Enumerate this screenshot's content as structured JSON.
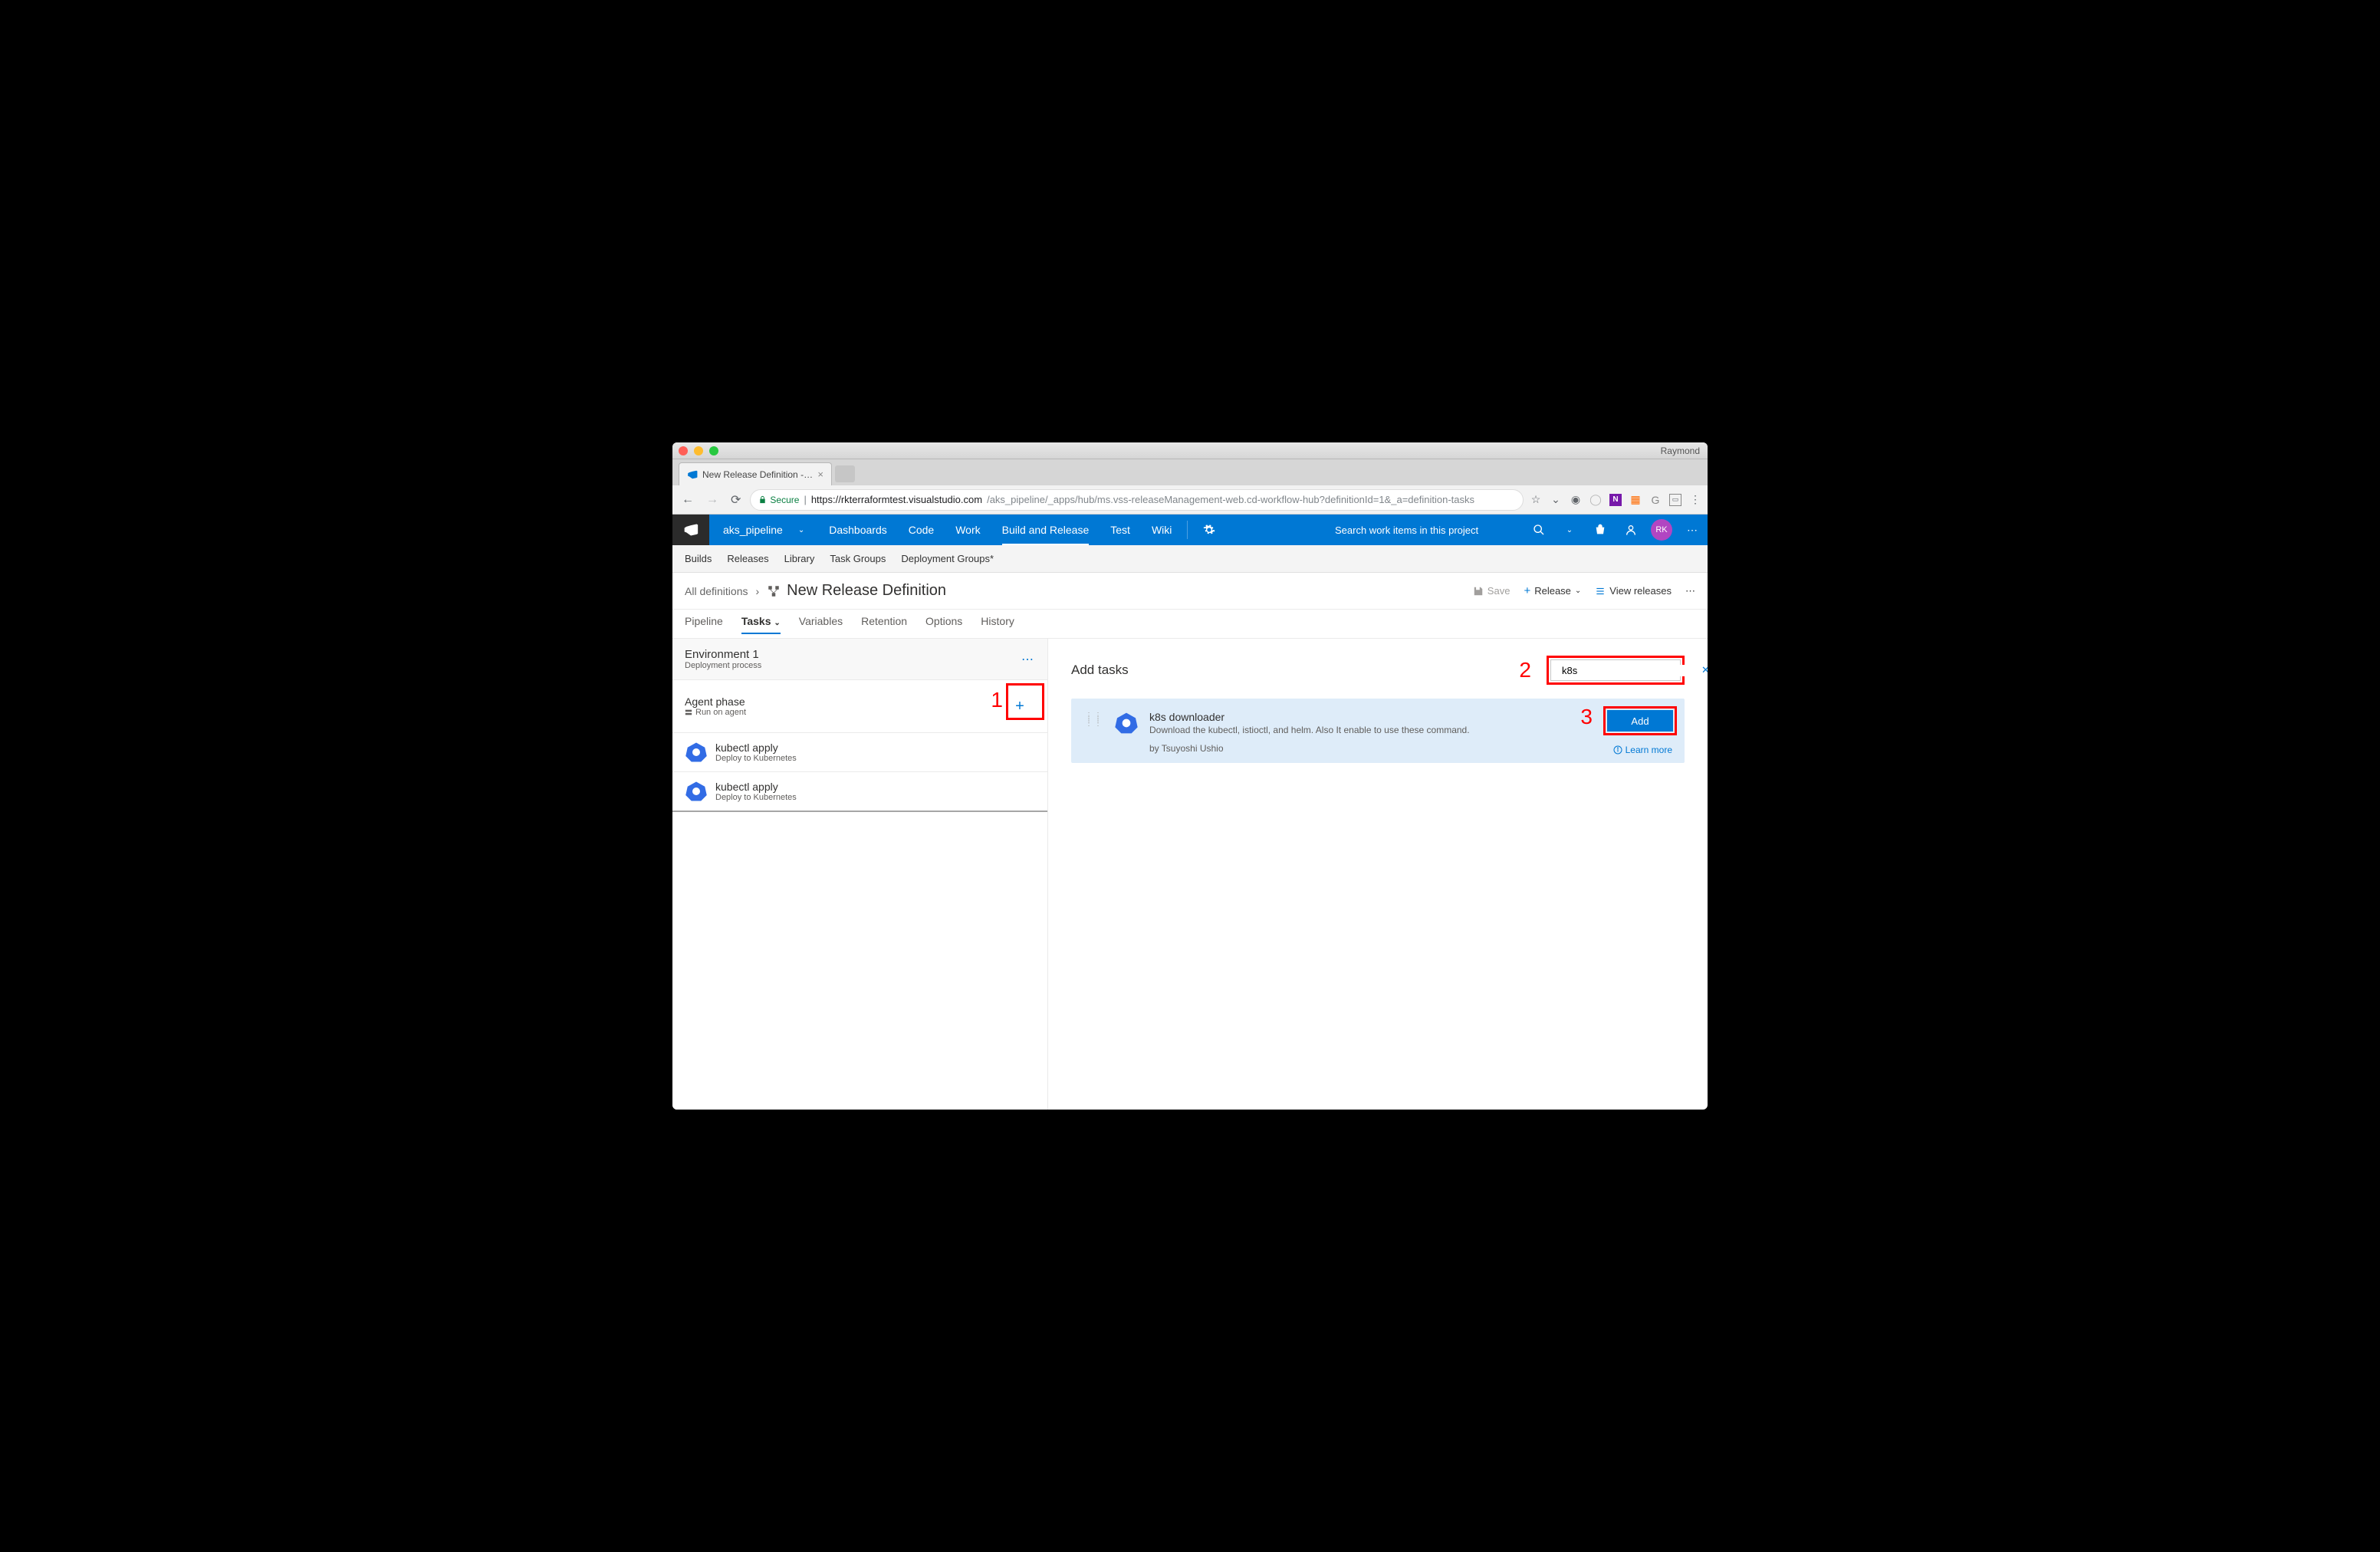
{
  "window": {
    "mac_user": "Raymond",
    "tab_title": "New Release Definition - Visua",
    "secure_label": "Secure",
    "url_host": "https://rkterraformtest.visualstudio.com",
    "url_path": "/aks_pipeline/_apps/hub/ms.vss-releaseManagement-web.cd-workflow-hub?definitionId=1&_a=definition-tasks"
  },
  "vsts_nav": {
    "project": "aks_pipeline",
    "items": [
      "Dashboards",
      "Code",
      "Work",
      "Build and Release",
      "Test",
      "Wiki"
    ],
    "active_index": 3,
    "search_placeholder": "Search work items in this project",
    "avatar_initials": "RK"
  },
  "subnav": [
    "Builds",
    "Releases",
    "Library",
    "Task Groups",
    "Deployment Groups*"
  ],
  "breadcrumb": {
    "root": "All definitions",
    "title": "New Release Definition"
  },
  "actions": {
    "save": "Save",
    "release": "Release",
    "view_releases": "View releases"
  },
  "tabs": {
    "items": [
      "Pipeline",
      "Tasks",
      "Variables",
      "Retention",
      "Options",
      "History"
    ],
    "active_index": 1
  },
  "left": {
    "env_name": "Environment 1",
    "env_sub": "Deployment process",
    "phase_name": "Agent phase",
    "phase_sub": "Run on agent",
    "tasks": [
      {
        "name": "kubectl apply",
        "sub": "Deploy to Kubernetes"
      },
      {
        "name": "kubectl apply",
        "sub": "Deploy to Kubernetes"
      }
    ]
  },
  "right": {
    "heading": "Add tasks",
    "search_value": "k8s",
    "result": {
      "title": "k8s downloader",
      "desc": "Download the kubectl, istioctl, and helm. Also It enable to use these command.",
      "author": "by Tsuyoshi Ushio",
      "add_label": "Add",
      "learn_more": "Learn more"
    }
  },
  "annotations": {
    "n1": "1",
    "n2": "2",
    "n3": "3"
  }
}
